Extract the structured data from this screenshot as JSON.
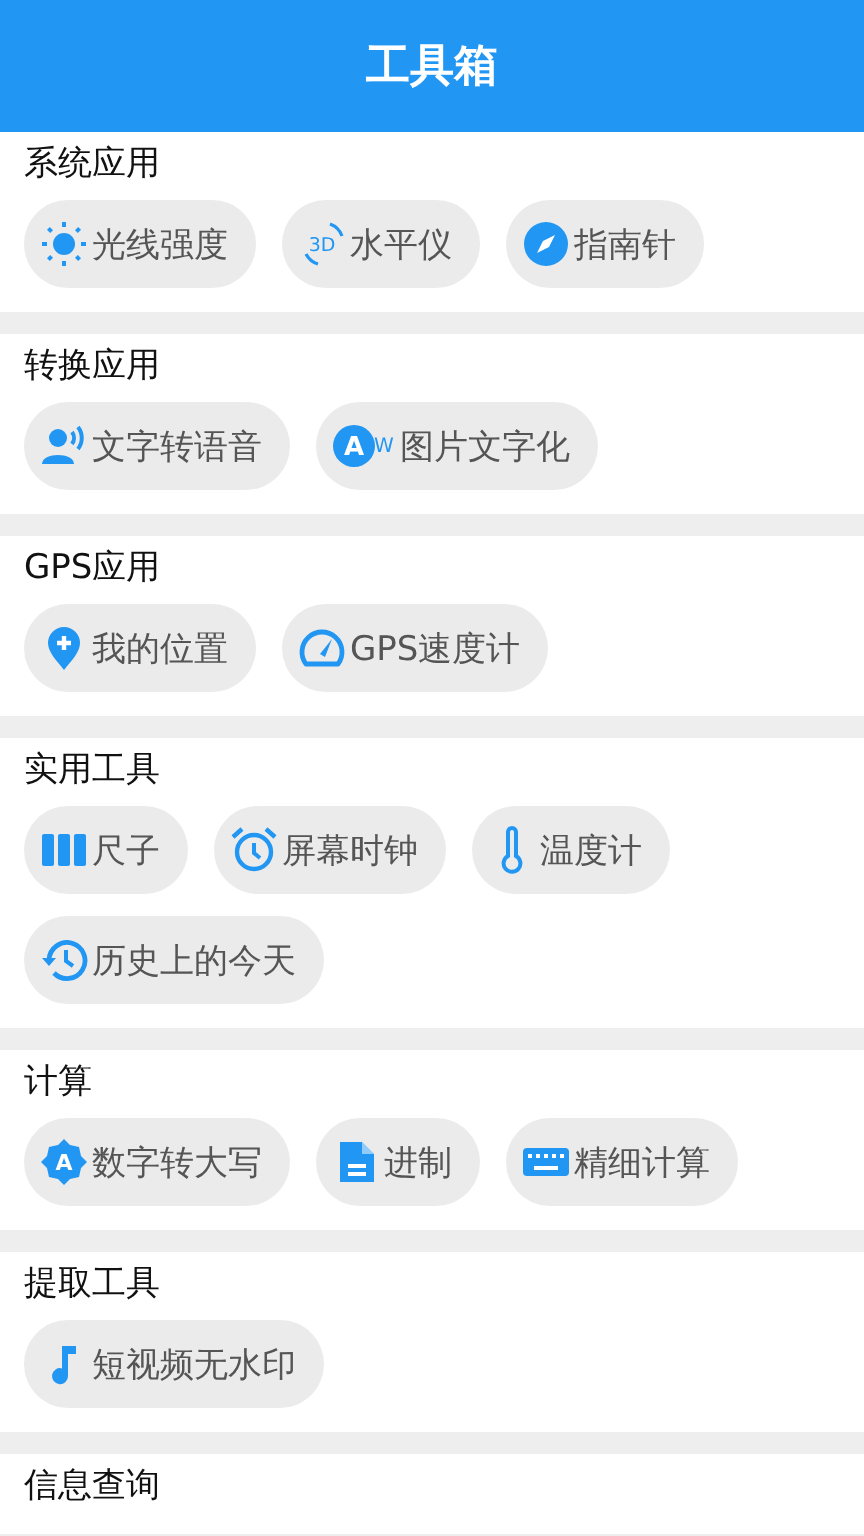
{
  "header": {
    "title": "工具箱"
  },
  "sections": [
    {
      "title": "系统应用",
      "tools": [
        {
          "label": "光线强度",
          "kind": "sun"
        },
        {
          "label": "水平仪",
          "kind": "rotate",
          "icon_text": "3D"
        },
        {
          "label": "指南针",
          "kind": "compass"
        }
      ]
    },
    {
      "title": "转换应用",
      "tools": [
        {
          "label": "文字转语音",
          "kind": "speaker"
        },
        {
          "label": "图片文字化",
          "kind": "aw",
          "icon_text": "A",
          "icon_text_2": "W"
        }
      ]
    },
    {
      "title": "GPS应用",
      "tools": [
        {
          "label": "我的位置",
          "kind": "pin"
        },
        {
          "label": "GPS速度计",
          "kind": "gauge"
        }
      ]
    },
    {
      "title": "实用工具",
      "tools": [
        {
          "label": "尺子",
          "kind": "bars"
        },
        {
          "label": "屏幕时钟",
          "kind": "alarm"
        },
        {
          "label": "温度计",
          "kind": "thermo"
        },
        {
          "label": "历史上的今天",
          "kind": "history"
        }
      ]
    },
    {
      "title": "计算",
      "tools": [
        {
          "label": "数字转大写",
          "kind": "badge",
          "icon_text": "A"
        },
        {
          "label": "进制",
          "kind": "file"
        },
        {
          "label": "精细计算",
          "kind": "keyboard"
        }
      ]
    },
    {
      "title": "提取工具",
      "tools": [
        {
          "label": "短视频无水印",
          "kind": "note"
        }
      ]
    },
    {
      "title": "信息查询"
    }
  ]
}
